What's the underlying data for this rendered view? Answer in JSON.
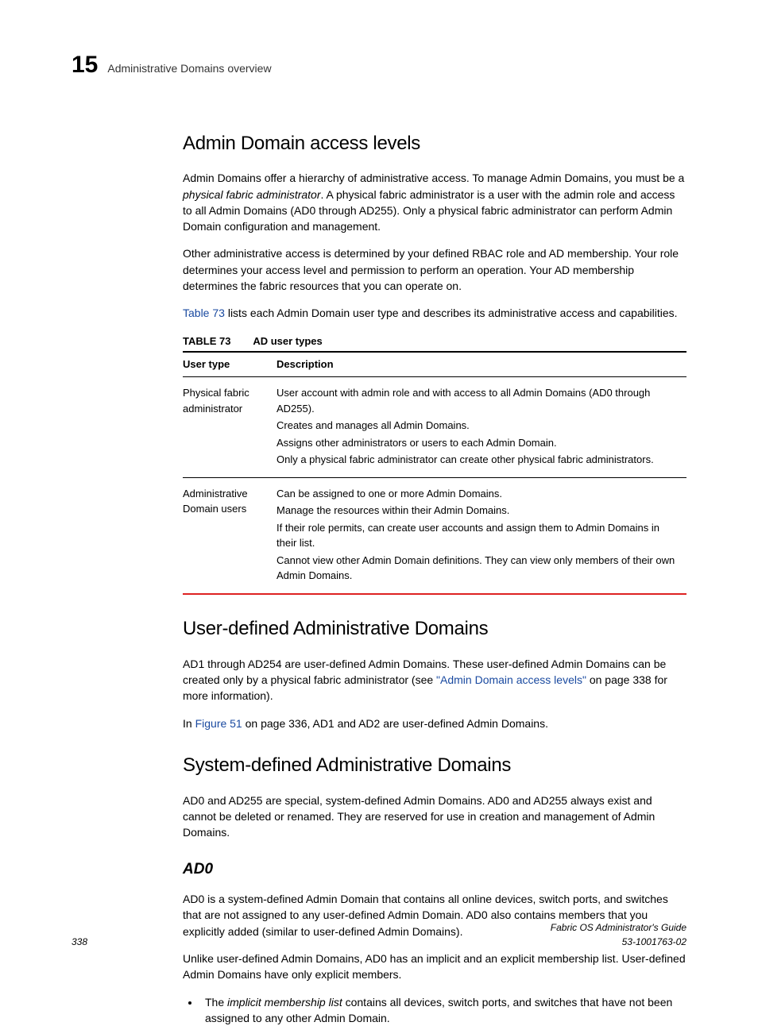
{
  "header": {
    "chapter": "15",
    "title": "Administrative Domains overview"
  },
  "s1": {
    "heading": "Admin Domain access levels",
    "p1a": "Admin Domains offer a hierarchy of administrative access. To manage Admin Domains, you must be a ",
    "p1term": "physical fabric administrator",
    "p1b": ". A physical fabric administrator is a user with the admin role and access to all Admin Domains (AD0 through AD255). Only a physical fabric administrator can perform Admin Domain configuration and management.",
    "p2": "Other administrative access is determined by your defined RBAC role and AD membership. Your role determines your access level and permission to perform an operation. Your AD membership determines the fabric resources that you can operate on.",
    "p3a": "",
    "p3link": "Table 73",
    "p3b": " lists each Admin Domain user type and describes its administrative access and capabilities."
  },
  "table": {
    "label": "TABLE 73",
    "title": "AD user types",
    "col1": "User type",
    "col2": "Description",
    "rows": [
      {
        "type": "Physical fabric administrator",
        "lines": [
          "User account with admin role and with access to all Admin Domains (AD0 through AD255).",
          "Creates and manages all Admin Domains.",
          "Assigns other administrators or users to each Admin Domain.",
          "Only a physical fabric administrator can create other physical fabric administrators."
        ]
      },
      {
        "type": "Administrative Domain users",
        "lines": [
          "Can be assigned to one or more Admin Domains.",
          "Manage the resources within their Admin Domains.",
          "If their role permits, can create user accounts and assign them to Admin Domains in their list.",
          "Cannot view other Admin Domain definitions. They can view only members of their own Admin Domains."
        ]
      }
    ]
  },
  "s2": {
    "heading": "User-defined Administrative Domains",
    "p1a": "AD1 through AD254 are user-defined Admin Domains. These user-defined Admin Domains can be created only by a physical fabric administrator (see ",
    "p1link": "\"Admin Domain access levels\"",
    "p1b": " on page 338 for more information).",
    "p2a": "In ",
    "p2link": "Figure 51",
    "p2b": " on page 336, AD1 and AD2 are user-defined Admin Domains."
  },
  "s3": {
    "heading": "System-defined Administrative Domains",
    "p1": "AD0 and AD255 are special, system-defined Admin Domains. AD0 and AD255 always exist and cannot be deleted or renamed. They are reserved for use in creation and management of Admin Domains."
  },
  "s4": {
    "heading": "AD0",
    "p1": "AD0 is a system-defined Admin Domain that contains all online devices, switch ports, and switches that are not assigned to any user-defined Admin Domain. AD0 also contains members that you explicitly added (similar to user-defined Admin Domains).",
    "p2": "Unlike user-defined Admin Domains, AD0 has an implicit and an explicit membership list. User-defined Admin Domains have only explicit members.",
    "b1a": "The ",
    "b1term": "implicit membership list",
    "b1b": " contains all devices, switch ports, and switches that have not been assigned to any other Admin Domain."
  },
  "footer": {
    "page": "338",
    "guide": "Fabric OS Administrator's Guide",
    "docnum": "53-1001763-02"
  }
}
